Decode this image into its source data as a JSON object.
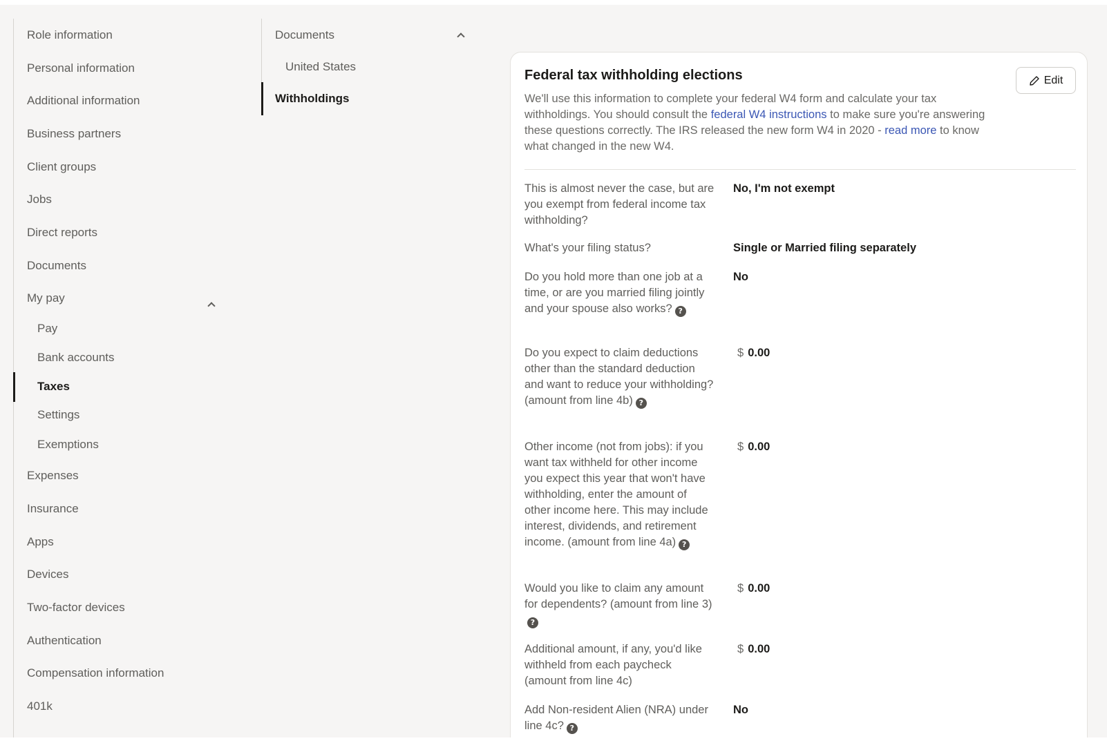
{
  "left_nav": {
    "items": [
      {
        "label": "Role information"
      },
      {
        "label": "Personal information"
      },
      {
        "label": "Additional information"
      },
      {
        "label": "Business partners"
      },
      {
        "label": "Client groups"
      },
      {
        "label": "Jobs"
      },
      {
        "label": "Direct reports"
      },
      {
        "label": "Documents"
      },
      {
        "label": "My pay"
      },
      {
        "label": "Pay"
      },
      {
        "label": "Bank accounts"
      },
      {
        "label": "Taxes"
      },
      {
        "label": "Settings"
      },
      {
        "label": "Exemptions"
      },
      {
        "label": "Expenses"
      },
      {
        "label": "Insurance"
      },
      {
        "label": "Apps"
      },
      {
        "label": "Devices"
      },
      {
        "label": "Two-factor devices"
      },
      {
        "label": "Authentication"
      },
      {
        "label": "Compensation information"
      },
      {
        "label": "401k"
      }
    ],
    "active": "Taxes"
  },
  "mid_nav": {
    "section": "Documents",
    "sub_item": "United States",
    "active_item": "Withholdings"
  },
  "card": {
    "title": "Federal tax withholding elections",
    "edit_label": "Edit",
    "desc_part1": "We'll use this information to complete your federal W4 form and calculate your tax withholdings. You should consult the ",
    "desc_link1": "federal W4 instructions",
    "desc_part2": " to make sure you're answering these questions correctly. The IRS released the new form W4 in 2020 - ",
    "desc_link2": "read more",
    "desc_part3": " to know what changed in the new W4.",
    "currency_symbol": "$",
    "questions": [
      {
        "q": "This is almost never the case, but are you exempt from federal income tax withholding?",
        "a": "No, I'm not exempt"
      },
      {
        "q": "What's your filing status?",
        "a": "Single or Married filing separately"
      },
      {
        "q": "Do you hold more than one job at a time, or are you married filing jointly and your spouse also works?",
        "a": "No"
      },
      {
        "q": "Do you expect to claim deductions other than the standard deduction and want to reduce your withholding? (amount from line 4b)",
        "a": "0.00"
      },
      {
        "q": "Other income (not from jobs): if you want tax withheld for other income you expect this year that won't have withholding, enter the amount of other income here. This may include interest, dividends, and retirement income. (amount from line 4a)",
        "a": "0.00"
      },
      {
        "q": "Would you like to claim any amount for dependents? (amount from line 3)",
        "a": "0.00"
      },
      {
        "q": "Additional amount, if any, you'd like withheld from each paycheck (amount from line 4c)",
        "a": "0.00"
      },
      {
        "q": "Add Non-resident Alien (NRA) under line 4c?",
        "a": "No"
      }
    ]
  },
  "icons": {
    "help": "question-circle-icon",
    "edit": "pencil-icon",
    "collapse": "chevron-up-icon"
  }
}
